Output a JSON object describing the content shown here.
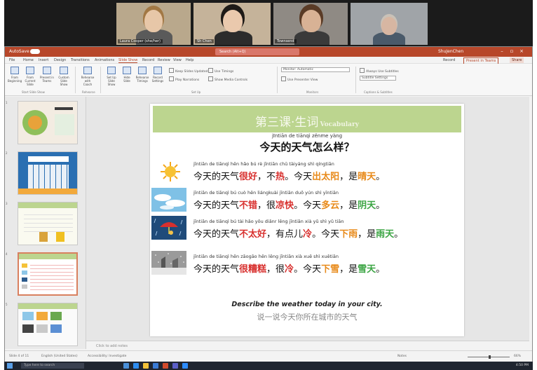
{
  "video_call": {
    "participants": [
      {
        "name": "Laura Cooper (she/her)",
        "bg": "#b9a88c",
        "face": "#e7c7a8",
        "hair": "#a27844",
        "shirt": "#5a5a5a"
      },
      {
        "name": "Sh Chen",
        "bg": "#c5b39a",
        "face": "#eac9ad",
        "hair": "#1e1a17",
        "shirt": "#2c2c2c"
      },
      {
        "name": "Townsend",
        "bg": "#8f8a84",
        "face": "#d8b295",
        "hair": "#5a3b26",
        "shirt": "#3a3a3a"
      },
      {
        "name": "",
        "bg": "#a0a4a8",
        "face": "#d7b6a2",
        "hair": "#c9c1b7",
        "shirt": "#4a5a6a"
      }
    ]
  },
  "ppt": {
    "autosave": "AutoSave",
    "search_placeholder": "Search (Alt+Q)",
    "user": "ShuJenChen",
    "tabs": [
      "File",
      "Home",
      "Insert",
      "Design",
      "Transitions",
      "Animations",
      "Slide Show",
      "Record",
      "Review",
      "View",
      "Help"
    ],
    "active_tab": "Slide Show",
    "record_label": "Record",
    "present_label": "Present in Teams",
    "share_label": "Share",
    "ribbon": {
      "buttons": [
        "From Beginning",
        "From Current Slide",
        "Present in Teams",
        "Custom Slide Show",
        "Rehearse with Coach",
        "Set Up Slide Show",
        "Hide Slide",
        "Rehearse Timings",
        "Record Settings"
      ],
      "checks": [
        "Keep Slides Updated",
        "Use Timings",
        "Play Narrations",
        "Show Media Controls",
        "Use Presenter View",
        "Always Use Subtitles"
      ],
      "monitor_label": "Monitor: Automatic",
      "subtitle_settings": "Subtitle Settings",
      "groups": [
        "Start Slide Show",
        "Rehearse",
        "Set Up",
        "Monitors",
        "Captions & Subtitles"
      ]
    },
    "notes_placeholder": "Click to add notes",
    "status": {
      "slide_info": "Slide 4 of 11",
      "language": "English (United States)",
      "accessibility": "Accessibility: Investigate",
      "notes": "Notes",
      "zoom": "66%"
    },
    "thumbnails": [
      {
        "num": "1",
        "theme": "salad"
      },
      {
        "num": "2",
        "theme": "calendar"
      },
      {
        "num": "3",
        "theme": "grid"
      },
      {
        "num": "4",
        "theme": "weather",
        "selected": true
      },
      {
        "num": "5",
        "theme": "pictures"
      }
    ]
  },
  "slide": {
    "title": "第三课·生词",
    "title_en": "Vocabulary",
    "question_pinyin": "jīntiān  de  tiānqì  zěnme yàng",
    "question_cn": "今天的天气怎么样？",
    "rows": [
      {
        "icon": "sun-icon",
        "pinyin": "jīntiān  de  tiānqì  hěn hǎo   bú  rè       jīntiān  chū tàiyáng        shì qíngtiān",
        "cn_parts": [
          {
            "t": "今天的天气",
            "c": ""
          },
          {
            "t": "很好",
            "c": "red"
          },
          {
            "t": "，不",
            "c": ""
          },
          {
            "t": "热",
            "c": "red"
          },
          {
            "t": "。今天",
            "c": ""
          },
          {
            "t": "出太阳",
            "c": "orange"
          },
          {
            "t": "，是",
            "c": ""
          },
          {
            "t": "晴天",
            "c": "orange"
          },
          {
            "t": "。",
            "c": ""
          }
        ]
      },
      {
        "icon": "cloud-icon",
        "pinyin": "jīntiān  de  tiānqì   bú cuò      hěn liángkuài    jīntiān  duō yún     shì yīntiān",
        "cn_parts": [
          {
            "t": "今天的天气",
            "c": ""
          },
          {
            "t": "不错",
            "c": "red"
          },
          {
            "t": "，很",
            "c": ""
          },
          {
            "t": "凉快",
            "c": "red"
          },
          {
            "t": "。今天",
            "c": ""
          },
          {
            "t": "多云",
            "c": "orange"
          },
          {
            "t": "，是",
            "c": ""
          },
          {
            "t": "阴天",
            "c": "green"
          },
          {
            "t": "。",
            "c": ""
          }
        ]
      },
      {
        "icon": "rain-icon",
        "pinyin": "jīntiān  de tiānqì   bú tài hǎo   yǒu diǎnr lěng   jīntiān xià yǔ        shì yǔ tiān",
        "cn_parts": [
          {
            "t": "今天的天气",
            "c": ""
          },
          {
            "t": "不太好",
            "c": "red"
          },
          {
            "t": "，有点儿",
            "c": ""
          },
          {
            "t": "冷",
            "c": "red"
          },
          {
            "t": "。今天",
            "c": ""
          },
          {
            "t": "下雨",
            "c": "orange"
          },
          {
            "t": "，是",
            "c": ""
          },
          {
            "t": "雨天",
            "c": "green"
          },
          {
            "t": "。",
            "c": ""
          }
        ]
      },
      {
        "icon": "snow-icon",
        "pinyin": "jīntiān  de tiānqì  hěn zāogāo     hěn  lěng      jīntiān  xià xuě        shì xuětiān",
        "cn_parts": [
          {
            "t": "今天的天气",
            "c": ""
          },
          {
            "t": "很糟糕",
            "c": "red"
          },
          {
            "t": "，很",
            "c": ""
          },
          {
            "t": "冷",
            "c": "red"
          },
          {
            "t": "。今天",
            "c": ""
          },
          {
            "t": "下雪",
            "c": "orange"
          },
          {
            "t": "，是",
            "c": ""
          },
          {
            "t": "雪天",
            "c": "green"
          },
          {
            "t": "。",
            "c": ""
          }
        ]
      }
    ],
    "prompt_en": "Describe the weather today in your city.",
    "prompt_cn": "说一说今天你所在城市的天气"
  },
  "taskbar": {
    "search_placeholder": "Type here to search",
    "tray": "4:50 PM"
  }
}
